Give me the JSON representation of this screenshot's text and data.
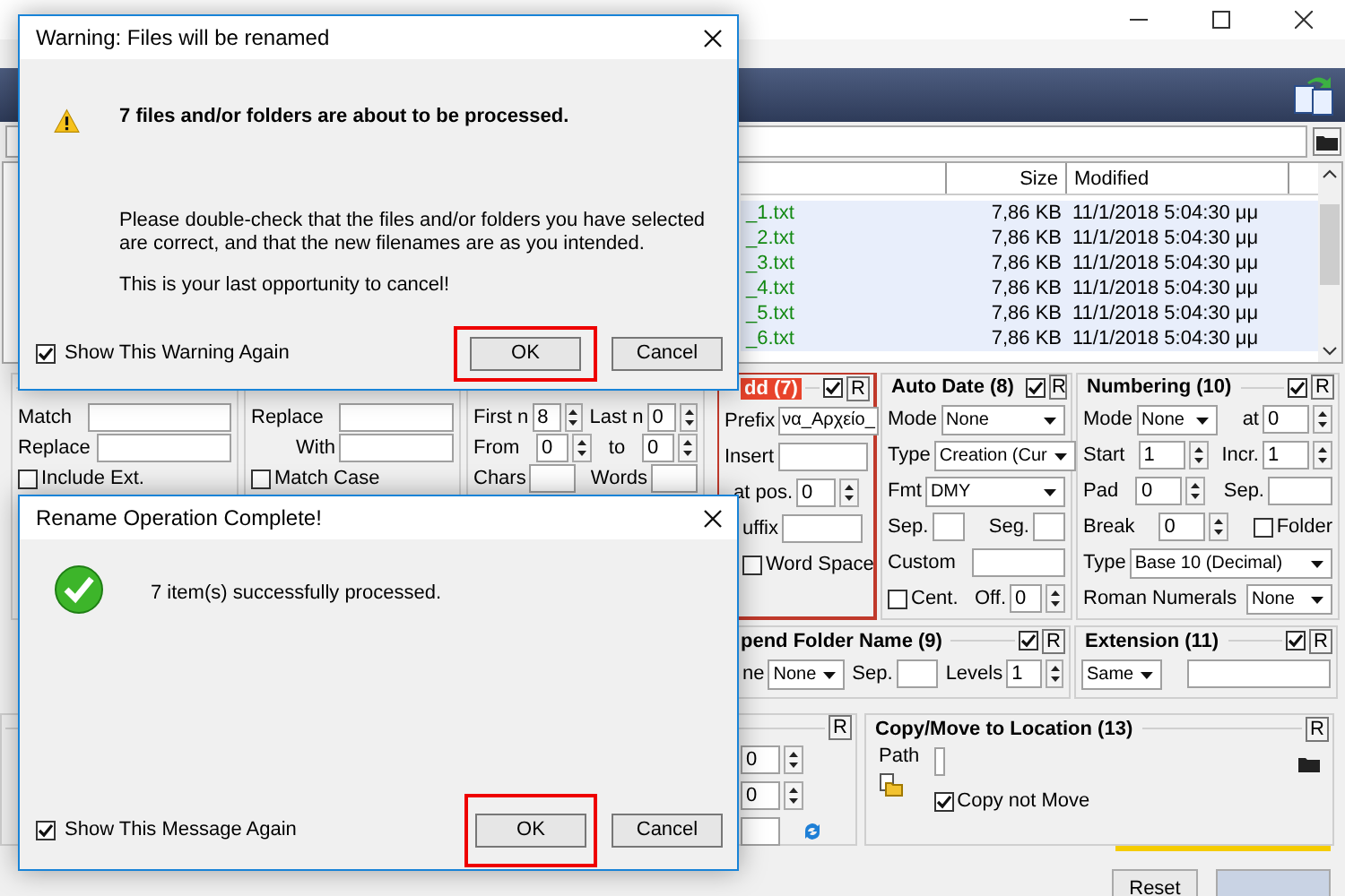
{
  "file_list": {
    "columns": [
      {
        "label": "Size"
      },
      {
        "label": "Modified"
      }
    ],
    "rows": [
      {
        "name": "_1.txt",
        "size": "7,86 KB",
        "modified": "11/1/2018 5:04:30 μμ",
        "selected": true
      },
      {
        "name": "_2.txt",
        "size": "7,86 KB",
        "modified": "11/1/2018 5:04:30 μμ",
        "selected": true
      },
      {
        "name": "_3.txt",
        "size": "7,86 KB",
        "modified": "11/1/2018 5:04:30 μμ",
        "selected": true
      },
      {
        "name": "_4.txt",
        "size": "7,86 KB",
        "modified": "11/1/2018 5:04:30 μμ",
        "selected": true
      },
      {
        "name": "_5.txt",
        "size": "7,86 KB",
        "modified": "11/1/2018 5:04:30 μμ",
        "selected": true
      },
      {
        "name": "_6.txt",
        "size": "7,86 KB",
        "modified": "11/1/2018 5:04:30 μμ",
        "selected": true
      }
    ]
  },
  "panels": {
    "regex": {
      "match": "Match",
      "replace": "Replace",
      "include_ext": {
        "label": "Include Ext.",
        "checked": false
      }
    },
    "replace": {
      "replace": "Replace",
      "with": "With",
      "match_case": {
        "label": "Match Case",
        "checked": false
      }
    },
    "remove": {
      "first_n": {
        "label": "First n",
        "value": "8"
      },
      "last_n": {
        "label": "Last n",
        "value": "0"
      },
      "from": {
        "label": "From",
        "value": "0"
      },
      "to": {
        "label": "to",
        "value": "0"
      },
      "chars": "Chars",
      "words": "Words"
    },
    "add": {
      "title": "dd (7)",
      "enabled": true,
      "reset": "R",
      "prefix": {
        "label": "Prefix",
        "value": "να_Αρχείο_"
      },
      "insert": "Insert",
      "at_pos": {
        "label": "at pos.",
        "value": "0"
      },
      "suffix": "uffix",
      "word_space": {
        "label": "Word Space",
        "checked": false
      }
    },
    "auto_date": {
      "title": "Auto Date (8)",
      "enabled": true,
      "reset": "R",
      "mode": {
        "label": "Mode",
        "value": "None"
      },
      "type": {
        "label": "Type",
        "value": "Creation (Cur"
      },
      "fmt": {
        "label": "Fmt",
        "value": "DMY"
      },
      "sep": "Sep.",
      "seg": "Seg.",
      "custom": "Custom",
      "cent": {
        "label": "Cent.",
        "checked": false
      },
      "off": {
        "label": "Off.",
        "value": "0"
      }
    },
    "numbering": {
      "title": "Numbering (10)",
      "enabled": true,
      "reset": "R",
      "mode": {
        "label": "Mode",
        "value": "None"
      },
      "at": {
        "label": "at",
        "value": "0"
      },
      "start": {
        "label": "Start",
        "value": "1"
      },
      "incr": {
        "label": "Incr.",
        "value": "1"
      },
      "pad": {
        "label": "Pad",
        "value": "0"
      },
      "sep": "Sep.",
      "break": {
        "label": "Break",
        "value": "0"
      },
      "folder": {
        "label": "Folder",
        "checked": false
      },
      "type": {
        "label": "Type",
        "value": "Base 10 (Decimal)"
      },
      "roman": {
        "label": "Roman Numerals",
        "value": "None"
      }
    },
    "append_folder": {
      "title": "pend Folder Name (9)",
      "enabled": true,
      "reset": "R",
      "name": {
        "label": "ne",
        "value": "None"
      },
      "sep": "Sep.",
      "levels": {
        "label": "Levels",
        "value": "1"
      }
    },
    "extension": {
      "title": "Extension (11)",
      "enabled": true,
      "reset": "R",
      "value": "Same"
    },
    "auto_number": {
      "reset": "R",
      "values": [
        "0",
        "0"
      ]
    },
    "copy_move": {
      "title": "Copy/Move to Location (13)",
      "reset": "R",
      "path": "Path",
      "copy_not_move": {
        "label": "Copy not Move",
        "checked": true
      }
    }
  },
  "reset_button": "Reset",
  "dialogs": [
    {
      "kind": "warning",
      "title": "Warning: Files will be renamed",
      "heading": "7 files and/or folders are about to be processed.",
      "paragraphs": [
        "Please double-check that the files and/or folders you have selected are correct, and that the new filenames are as you intended.",
        "This is your last opportunity to cancel!"
      ],
      "show_again": {
        "label": "Show This Warning Again",
        "checked": true
      },
      "buttons": [
        {
          "label": "OK",
          "highlighted": true
        },
        {
          "label": "Cancel",
          "highlighted": false
        }
      ]
    },
    {
      "kind": "success",
      "title": "Rename Operation Complete!",
      "message": "7 item(s) successfully processed.",
      "show_again": {
        "label": "Show This Message Again",
        "checked": true
      },
      "buttons": [
        {
          "label": "OK",
          "highlighted": true
        },
        {
          "label": "Cancel",
          "highlighted": false
        }
      ]
    }
  ]
}
